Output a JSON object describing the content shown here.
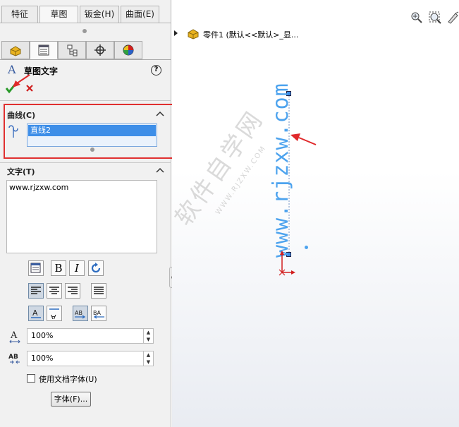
{
  "tabs": [
    "特征",
    "草图",
    "钣金(H)",
    "曲面(E)"
  ],
  "panel_tabs": [
    "feature-manager-icon",
    "property-manager-icon",
    "configuration-manager-icon",
    "dimxpert-icon",
    "display-manager-icon"
  ],
  "property_manager": {
    "title": "草图文字",
    "help_label": "?",
    "curve_section": {
      "title": "曲线(C)",
      "selected_item": "直线2"
    },
    "text_section": {
      "title": "文字(T)",
      "text_value": "www.rjzxw.com"
    },
    "width_factor": "100%",
    "spacing": "100%",
    "use_document_font_label": "使用文档字体(U)",
    "font_button_label": "字体(F)..."
  },
  "feature_tree": {
    "part_label": "零件1  (默认<<默认>_显..."
  },
  "canvas": {
    "sketch_text": "www.rjzxw.com",
    "watermark_text": "软件自学网",
    "watermark_url": "WWW.RJZXW.COM"
  },
  "colors": {
    "highlight_box": "#e03030",
    "selection_blue": "#3d8ee8",
    "sketch_text": "#4da3ee",
    "arrow_red": "#e0282a"
  }
}
